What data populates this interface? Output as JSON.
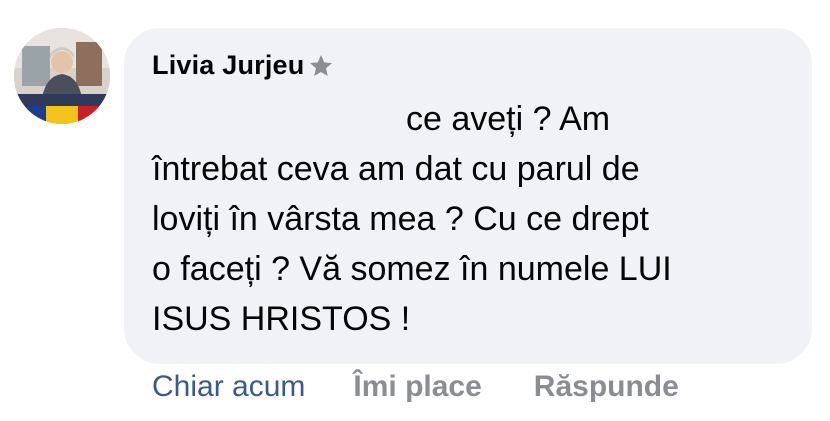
{
  "comment": {
    "author": "Livia Jurjeu",
    "author_badge_icon": "star-icon",
    "text_lines": [
      "ce aveți ? Am",
      "întrebat ceva am dat cu parul de",
      "loviți în vârsta mea ? Cu ce drept",
      "o faceți ? Vă somez în numele LUI",
      "ISUS HRISTOS !"
    ]
  },
  "actions": {
    "time": "Chiar acum",
    "like": "Îmi place",
    "reply": "Răspunde"
  },
  "colors": {
    "bubble": "#f0f2f5",
    "time_link": "#385898",
    "muted_action": "#8a8d91",
    "text": "#050505"
  }
}
